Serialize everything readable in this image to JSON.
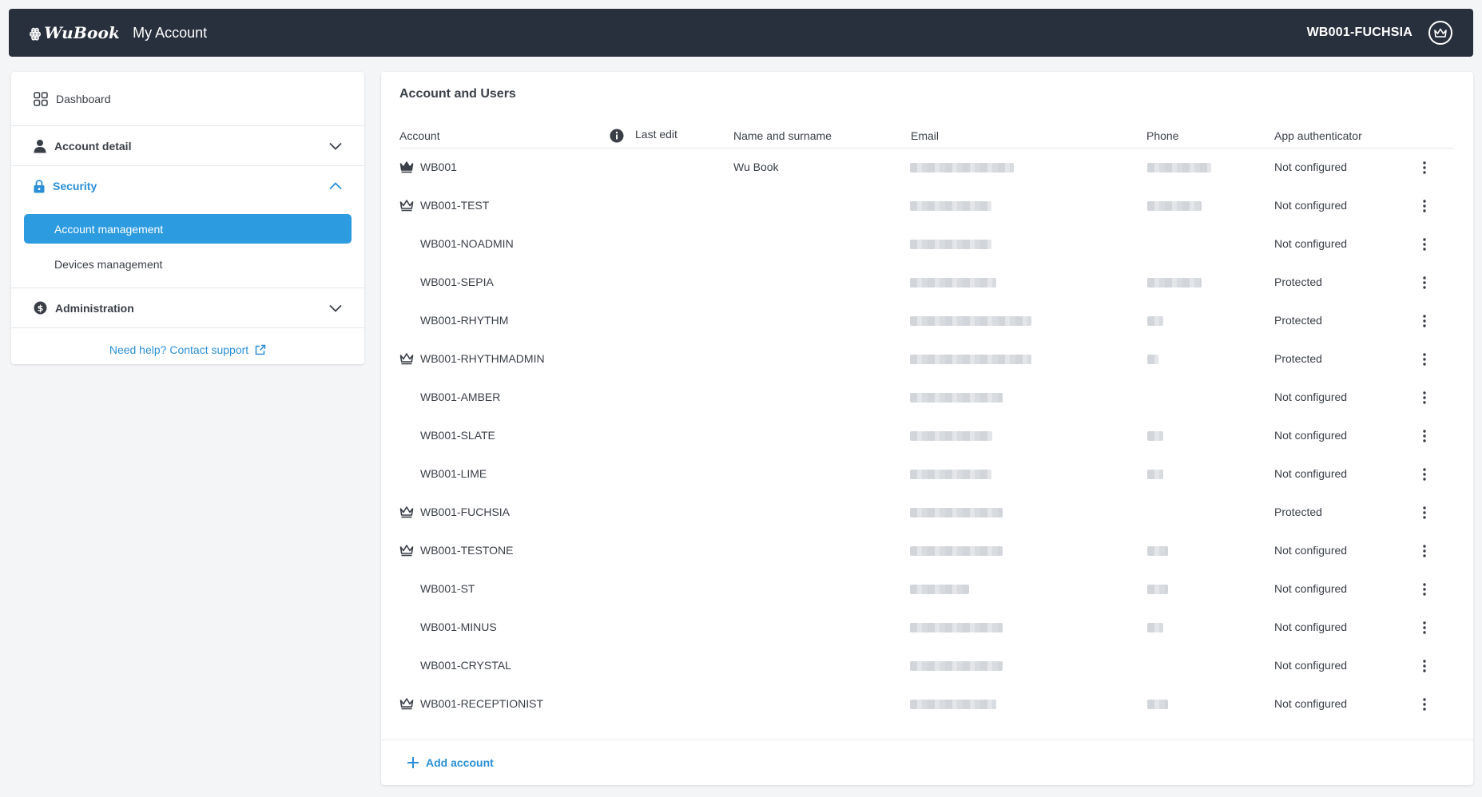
{
  "header": {
    "logo_text": "WuBook",
    "app_title": "My Account",
    "user_name": "WB001-FUCHSIA"
  },
  "sidebar": {
    "dashboard_label": "Dashboard",
    "sections": [
      {
        "label": "Account detail",
        "expanded": false
      },
      {
        "label": "Security",
        "expanded": true,
        "items": [
          "Account management",
          "Devices management"
        ]
      },
      {
        "label": "Administration",
        "expanded": false
      }
    ],
    "help_text": "Need help? Contact support"
  },
  "main": {
    "title": "Account and Users",
    "columns": [
      "Account",
      "Last edit",
      "Name and surname",
      "Email",
      "Phone",
      "App authenticator"
    ],
    "rows": [
      {
        "account": "WB001",
        "crown": "filled",
        "name": "Wu Book",
        "email_blur": 130,
        "phone_blur": 80,
        "app_auth": "Not configured"
      },
      {
        "account": "WB001-TEST",
        "crown": "outline",
        "name": "",
        "email_blur": 102,
        "phone_blur": 68,
        "app_auth": "Not configured"
      },
      {
        "account": "WB001-NOADMIN",
        "crown": "none",
        "name": "",
        "email_blur": 102,
        "phone_blur": 0,
        "app_auth": "Not configured"
      },
      {
        "account": "WB001-SEPIA",
        "crown": "none",
        "name": "",
        "email_blur": 108,
        "phone_blur": 68,
        "app_auth": "Protected"
      },
      {
        "account": "WB001-RHYTHM",
        "crown": "none",
        "name": "",
        "email_blur": 152,
        "phone_blur": 20,
        "app_auth": "Protected"
      },
      {
        "account": "WB001-RHYTHMADMIN",
        "crown": "outline",
        "name": "",
        "email_blur": 152,
        "phone_blur": 14,
        "app_auth": "Protected"
      },
      {
        "account": "WB001-AMBER",
        "crown": "none",
        "name": "",
        "email_blur": 116,
        "phone_blur": 0,
        "app_auth": "Not configured"
      },
      {
        "account": "WB001-SLATE",
        "crown": "none",
        "name": "",
        "email_blur": 103,
        "phone_blur": 20,
        "app_auth": "Not configured"
      },
      {
        "account": "WB001-LIME",
        "crown": "none",
        "name": "",
        "email_blur": 102,
        "phone_blur": 20,
        "app_auth": "Not configured"
      },
      {
        "account": "WB001-FUCHSIA",
        "crown": "outline",
        "name": "",
        "email_blur": 116,
        "phone_blur": 0,
        "app_auth": "Protected"
      },
      {
        "account": "WB001-TESTONE",
        "crown": "outline",
        "name": "",
        "email_blur": 116,
        "phone_blur": 26,
        "app_auth": "Not configured"
      },
      {
        "account": "WB001-ST",
        "crown": "none",
        "name": "",
        "email_blur": 74,
        "phone_blur": 26,
        "app_auth": "Not configured"
      },
      {
        "account": "WB001-MINUS",
        "crown": "none",
        "name": "",
        "email_blur": 116,
        "phone_blur": 20,
        "app_auth": "Not configured"
      },
      {
        "account": "WB001-CRYSTAL",
        "crown": "none",
        "name": "",
        "email_blur": 116,
        "phone_blur": 0,
        "app_auth": "Not configured"
      },
      {
        "account": "WB001-RECEPTIONIST",
        "crown": "outline",
        "name": "",
        "email_blur": 108,
        "phone_blur": 26,
        "app_auth": "Not configured"
      }
    ],
    "add_account_label": "Add account"
  },
  "colors": {
    "topbar": "#29303d",
    "accent": "#2a8fd6",
    "active_item": "#2d9be0"
  }
}
